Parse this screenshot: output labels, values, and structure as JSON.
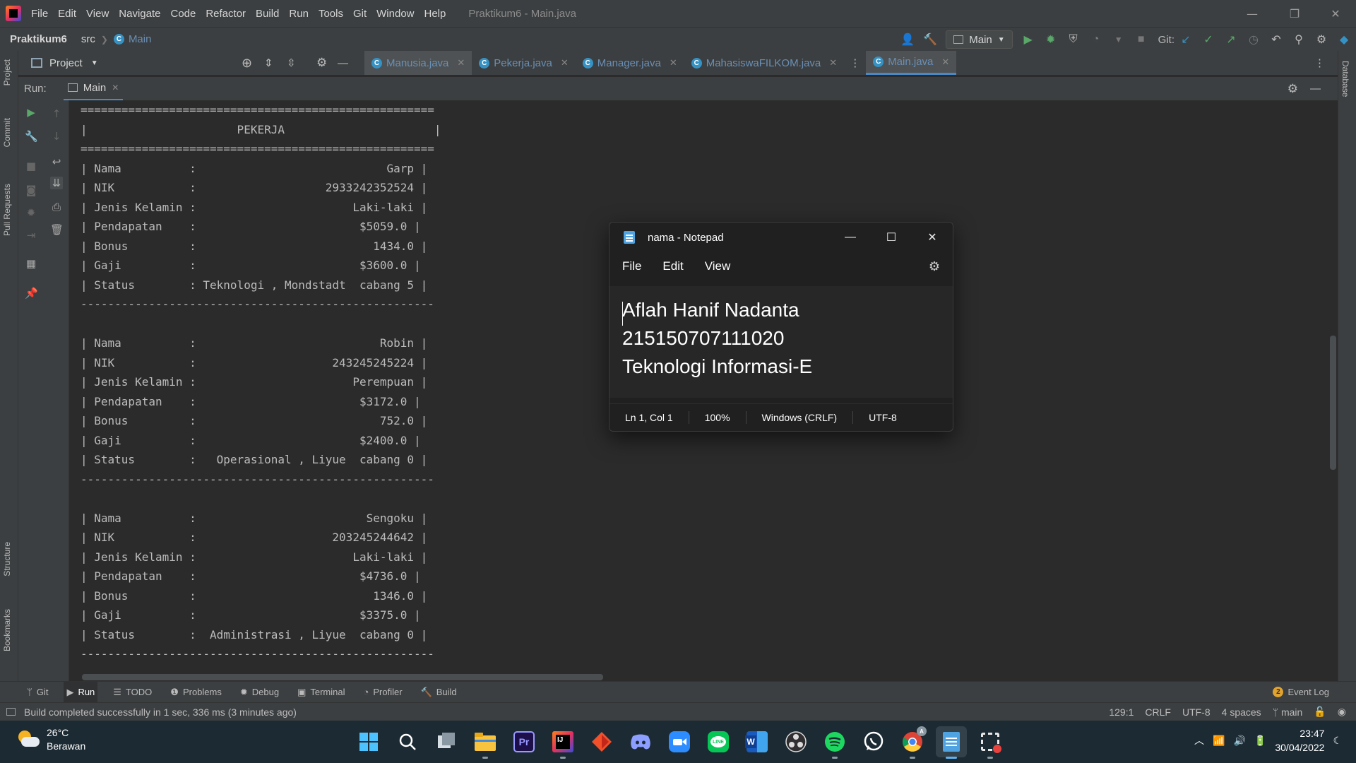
{
  "ide": {
    "menu": [
      "File",
      "Edit",
      "View",
      "Navigate",
      "Code",
      "Refactor",
      "Build",
      "Run",
      "Tools",
      "Git",
      "Window",
      "Help"
    ],
    "window_title": "Praktikum6 - Main.java",
    "breadcrumb": {
      "project": "Praktikum6",
      "folder": "src",
      "file": "Main"
    },
    "run_config": "Main",
    "git_label": "Git:",
    "project_panel_label": "Project",
    "tabs": [
      "Manusia.java",
      "Pekerja.java",
      "Manager.java",
      "MahasiswaFILKOM.java",
      "Main.java"
    ],
    "run_label": "Run:",
    "run_tab": "Main",
    "left_vertical_tabs": [
      "Project",
      "Commit",
      "Pull Requests",
      "Structure",
      "Bookmarks"
    ],
    "right_vertical_tabs": [
      "Database"
    ],
    "console_lines": [
      "====================================================",
      "|                      PEKERJA                      |",
      "====================================================",
      "| Nama          :                            Garp |",
      "| NIK           :                   2933242352524 |",
      "| Jenis Kelamin :                       Laki-laki |",
      "| Pendapatan    :                        $5059.0 |",
      "| Bonus         :                          1434.0 |",
      "| Gaji          :                        $3600.0 |",
      "| Status        : Teknologi , Mondstadt  cabang 5 |",
      "----------------------------------------------------",
      "",
      "| Nama          :                           Robin |",
      "| NIK           :                    243245245224 |",
      "| Jenis Kelamin :                       Perempuan |",
      "| Pendapatan    :                        $3172.0 |",
      "| Bonus         :                           752.0 |",
      "| Gaji          :                        $2400.0 |",
      "| Status        :   Operasional , Liyue  cabang 0 |",
      "----------------------------------------------------",
      "",
      "| Nama          :                         Sengoku |",
      "| NIK           :                    203245244642 |",
      "| Jenis Kelamin :                       Laki-laki |",
      "| Pendapatan    :                        $4736.0 |",
      "| Bonus         :                          1346.0 |",
      "| Gaji          :                        $3375.0 |",
      "| Status        :  Administrasi , Liyue  cabang 0 |",
      "----------------------------------------------------"
    ],
    "bottom_tabs": [
      "Git",
      "Run",
      "TODO",
      "Problems",
      "Debug",
      "Terminal",
      "Profiler",
      "Build"
    ],
    "event_log": {
      "count": "2",
      "label": "Event Log"
    },
    "status_message": "Build completed successfully in 1 sec, 336 ms (3 minutes ago)",
    "status_right": [
      "129:1",
      "CRLF",
      "UTF-8",
      "4 spaces",
      "main"
    ]
  },
  "notepad": {
    "title": "nama - Notepad",
    "menu": [
      "File",
      "Edit",
      "View"
    ],
    "lines": [
      "Aflah Hanif Nadanta",
      "215150707111020",
      "Teknologi Informasi-E"
    ],
    "status": [
      "Ln 1, Col 1",
      "100%",
      "Windows (CRLF)",
      "UTF-8"
    ]
  },
  "taskbar": {
    "weather": {
      "temp": "26°C",
      "desc": "Berawan"
    },
    "apps": [
      "start",
      "search",
      "task-view",
      "file-explorer",
      "premiere-pro",
      "intellij",
      "git-kraken",
      "discord",
      "zoom",
      "line",
      "word",
      "obs",
      "spotify",
      "whatsapp",
      "chrome",
      "notepad",
      "snipping-tool"
    ],
    "clock": {
      "time": "23:47",
      "date": "30/04/2022"
    }
  },
  "colors": {
    "ide_bg": "#2b2b2b",
    "ide_panel": "#3c3f41",
    "accent": "#4a88c7",
    "taskbar": "#1c2a33",
    "notepad_bg": "#202020"
  }
}
